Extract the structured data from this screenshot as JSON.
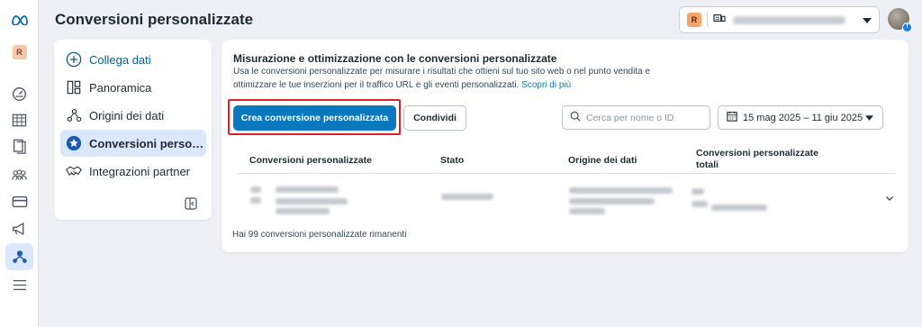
{
  "rail": {
    "logo": "meta-logo",
    "account_initial": "R",
    "icons": [
      "dashboard-icon",
      "table-icon",
      "pages-icon",
      "audience-icon",
      "billing-icon",
      "megaphone-icon",
      "events-manager-icon",
      "menu-icon"
    ]
  },
  "header": {
    "title": "Conversioni personalizzate",
    "account_initial": "R"
  },
  "nav": {
    "items": [
      {
        "label": "Collega dati",
        "icon": "plus-circle-icon"
      },
      {
        "label": "Panoramica",
        "icon": "layout-icon"
      },
      {
        "label": "Origini dei dati",
        "icon": "data-sources-icon"
      },
      {
        "label": "Conversioni perso…",
        "icon": "star-badge-icon"
      },
      {
        "label": "Integrazioni partner",
        "icon": "handshake-icon"
      }
    ],
    "selected_index": 3
  },
  "main": {
    "heading": "Misurazione e ottimizzazione con le conversioni personalizzate",
    "description": "Usa le conversioni personalizzate per misurare i risultati che ottieni sul tuo sito web o nel punto vendita e ottimizzare le tue inserzioni per il traffico URL e gli eventi personalizzati.",
    "learn_more": "Scopri di più",
    "create_button": "Crea conversione personalizzata",
    "share_button": "Condividi",
    "search_placeholder": "Cerca per nome o ID",
    "date_range": "15 mag 2025 – 11 giu 2025",
    "table": {
      "headers": [
        "Conversioni personalizzate",
        "Stato",
        "Origine dei dati",
        "Conversioni personalizzate totali"
      ]
    },
    "footer_note": "Hai 99 conversioni personalizzate rimanenti"
  },
  "colors": {
    "primary": "#0a78be",
    "highlight": "#d9232a",
    "selected_bg": "#dbe7fb"
  }
}
